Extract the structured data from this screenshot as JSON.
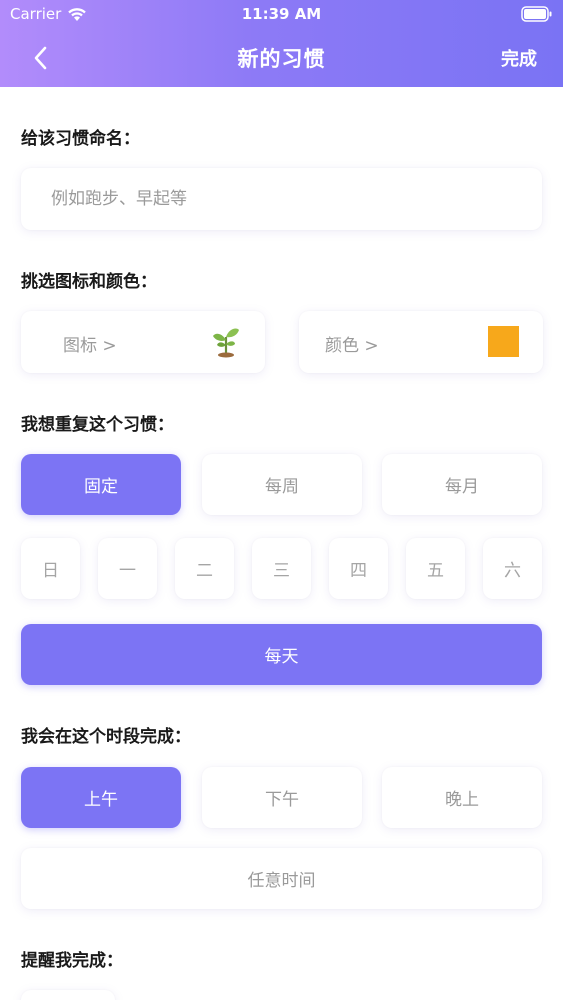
{
  "status_bar": {
    "carrier": "Carrier",
    "time": "11:39 AM"
  },
  "nav": {
    "title": "新的习惯",
    "done_label": "完成"
  },
  "name_section": {
    "label": "给该习惯命名：",
    "placeholder": "例如跑步、早起等",
    "value": ""
  },
  "style_section": {
    "label": "挑选图标和颜色：",
    "icon_picker_label": "图标 >",
    "icon_name": "sprout-icon",
    "color_picker_label": "颜色 >",
    "selected_color": "#f7a81b"
  },
  "repeat_section": {
    "label": "我想重复这个习惯：",
    "modes": [
      {
        "label": "固定",
        "selected": true
      },
      {
        "label": "每周",
        "selected": false
      },
      {
        "label": "每月",
        "selected": false
      }
    ],
    "weekdays": [
      "日",
      "一",
      "二",
      "三",
      "四",
      "五",
      "六"
    ],
    "everyday_label": "每天"
  },
  "time_section": {
    "label": "我会在这个时段完成：",
    "periods": [
      {
        "label": "上午",
        "selected": true
      },
      {
        "label": "下午",
        "selected": false
      },
      {
        "label": "晚上",
        "selected": false
      }
    ],
    "anytime_label": "任意时间"
  },
  "reminder_section": {
    "label": "提醒我完成："
  },
  "colors": {
    "accent": "#7c74f4",
    "header_start": "#b28cfb",
    "header_end": "#7a73f4",
    "muted_text": "#9a9a9a"
  }
}
